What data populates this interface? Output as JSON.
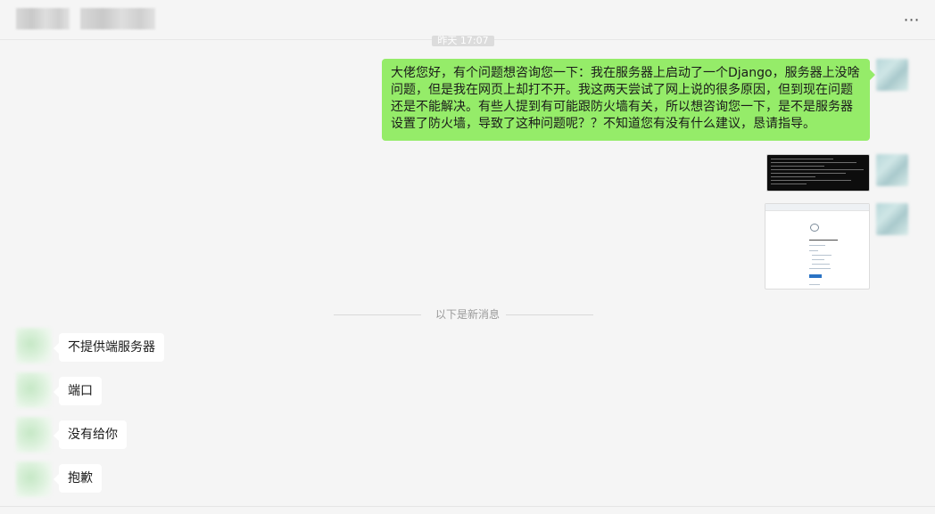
{
  "header": {
    "more_label": "⋯"
  },
  "chat": {
    "timestamp": "昨天 17:07",
    "outgoing_text": "大佬您好，有个问题想咨询您一下：我在服务器上启动了一个Django，服务器上没啥问题，但是我在网页上却打不开。我这两天尝试了网上说的很多原因，但到现在问题还是不能解决。有些人提到有可能跟防火墙有关，所以想咨询您一下，是不是服务器设置了防火墙，导致了这种问题呢？？不知道您有没有什么建议，恳请指导。",
    "divider_text": "以下是新消息",
    "incoming": [
      {
        "text": "不提供端服务器"
      },
      {
        "text": "端口"
      },
      {
        "text": "没有给你"
      },
      {
        "text": "抱歉"
      }
    ]
  },
  "colors": {
    "outgoing_bubble": "#95ec69",
    "incoming_bubble": "#ffffff",
    "background": "#f5f5f5"
  }
}
